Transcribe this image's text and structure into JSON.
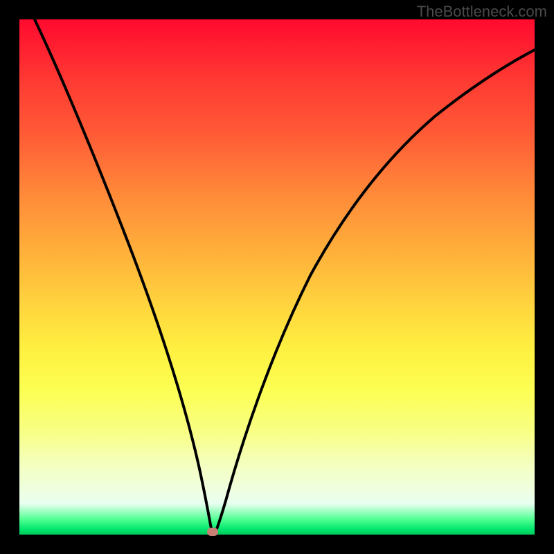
{
  "attribution": "TheBottleneck.com",
  "chart_data": {
    "type": "line",
    "title": "",
    "xlabel": "",
    "ylabel": "",
    "xlim": [
      0,
      100
    ],
    "ylim": [
      0,
      100
    ],
    "series": [
      {
        "name": "curve",
        "x": [
          3,
          6,
          10,
          14,
          18,
          22,
          26,
          30,
          32,
          34,
          35.8,
          37,
          37.5,
          38,
          40,
          45,
          52,
          60,
          68,
          76,
          84,
          92,
          100
        ],
        "y": [
          100,
          92,
          82,
          71.5,
          60.5,
          49.5,
          38,
          26,
          20,
          13,
          5,
          2,
          0.5,
          1.5,
          9,
          28,
          48,
          63,
          72,
          78,
          82.5,
          86,
          89
        ]
      }
    ],
    "marker": {
      "x": 37.5,
      "y": 0.5,
      "color": "#c98176"
    },
    "background_gradient": {
      "direction": "vertical",
      "stops": [
        {
          "pos": 0,
          "color": "#ff0a2e"
        },
        {
          "pos": 0.5,
          "color": "#ffd03d"
        },
        {
          "pos": 0.8,
          "color": "#f8ff84"
        },
        {
          "pos": 0.97,
          "color": "#49ff8e"
        },
        {
          "pos": 1.0,
          "color": "#00c85a"
        }
      ]
    }
  },
  "marker_style": {
    "left_pct": 37.5,
    "top_pct": 99.5
  }
}
